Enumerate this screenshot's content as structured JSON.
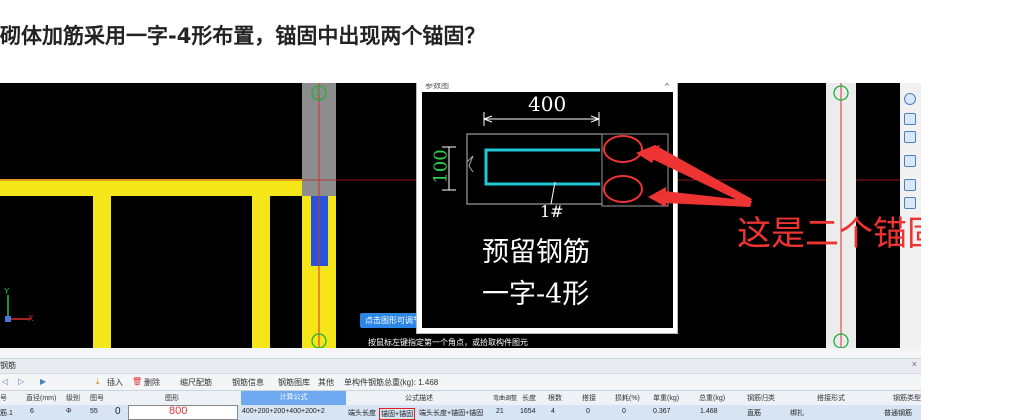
{
  "question": {
    "title": "砌体加筋采用一字-4形布置，锚固中出现两个锚固？"
  },
  "cad": {
    "axis_label": "3",
    "axis_y": "Y",
    "axis_x": "X",
    "tooltip": "点击图形可调节",
    "status_hint": "按鼠标左键指定第一个角点，或拾取构件图元"
  },
  "dialog": {
    "title": "参数图",
    "close": "×",
    "dimension_length": "400",
    "dimension_height": "100",
    "bar_tag": "1#",
    "caption_line1": "预留钢筋",
    "caption_line2": "一字-4形"
  },
  "annotation": {
    "text": "这是二个锚固"
  },
  "panel": {
    "name": "钢筋",
    "close": "×",
    "toolbar": {
      "insert": "插入",
      "delete": "删除",
      "scale_rebar": "缩尺配筋",
      "rebar_info": "钢筋信息",
      "rebar_gallery": "钢筋图库",
      "other": "其他",
      "total_weight": "单构件钢筋总重(kg): 1.468"
    },
    "columns": [
      "号",
      "直径(mm)",
      "级别",
      "图号",
      "图形",
      "计算公式",
      "公式描述",
      "弯曲调整",
      "长度",
      "根数",
      "搭接",
      "损耗(%)",
      "单重(kg)",
      "总重(kg)",
      "钢筋归类",
      "搭接形式",
      "钢筋类型"
    ],
    "row": {
      "name": "筋.1",
      "diameter": "6",
      "grade": "Φ",
      "figure_no": "55",
      "count_marker": "0",
      "shape_value": "800",
      "formula": "400+200+200+400+200+2",
      "desc_prefix": "端头长度",
      "desc_boxed": "锚固+锚固",
      "desc_suffix": "端头长度+锚固+锚固",
      "bend": "21",
      "length": "1654",
      "qty": "4",
      "lap": "0",
      "loss": "0",
      "unit_weight": "0.367",
      "total_weight": "1.468",
      "category": "直筋",
      "lap_type": "绑扎",
      "rebar_type": "普通钢筋"
    }
  },
  "colors": {
    "annotation_red": "#ee3333",
    "rebar_cyan": "#22c7d6",
    "wall_yellow": "#f5e61a",
    "highlight_blue": "#6fa9f2"
  }
}
